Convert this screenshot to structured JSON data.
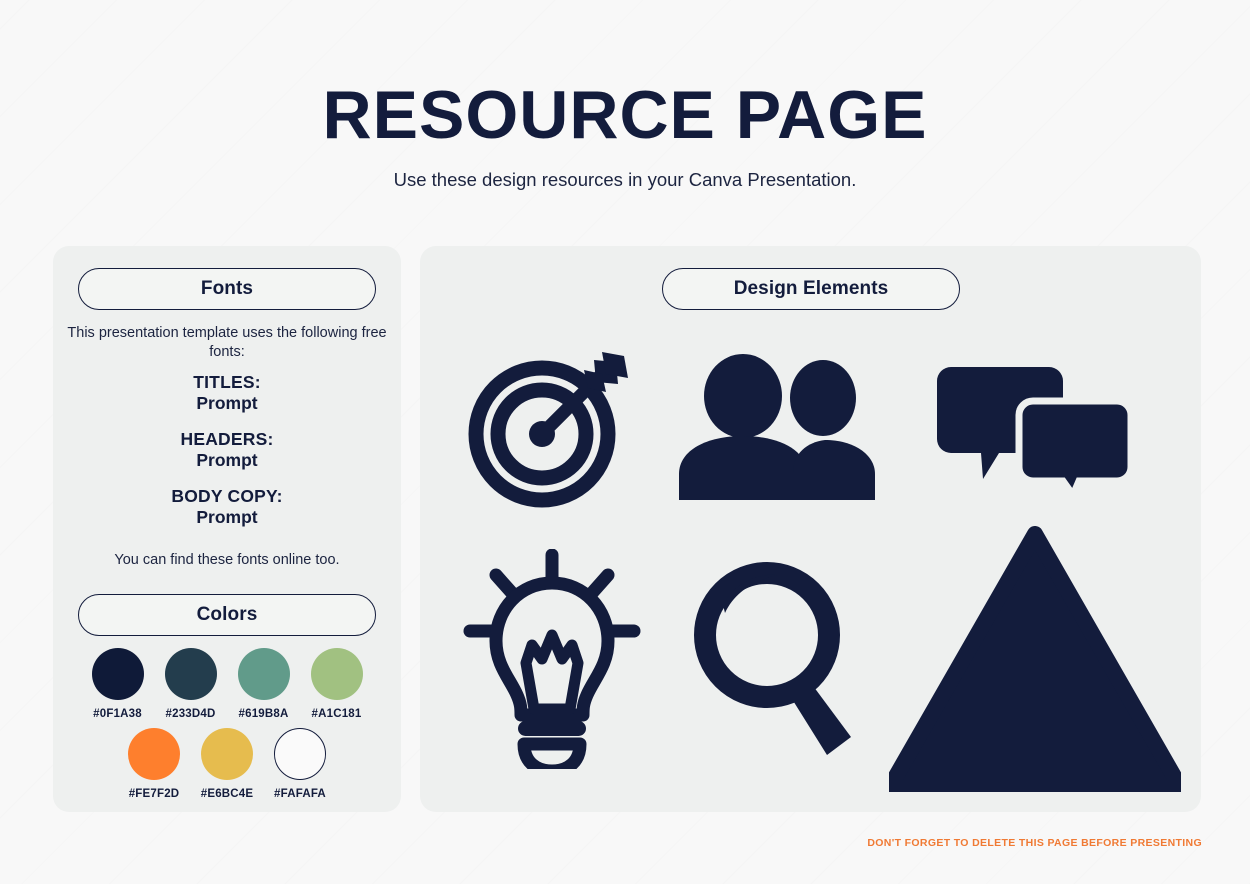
{
  "page": {
    "title": "RESOURCE PAGE",
    "subtitle": "Use these design resources in your Canva Presentation.",
    "background_color": "#F8F8F8",
    "ink_color": "#131C3C",
    "panel_color": "#EEF0EF"
  },
  "fonts_panel": {
    "heading": "Fonts",
    "intro": "This presentation template uses the following free fonts:",
    "groups": [
      {
        "role": "TITLES:",
        "font": "Prompt"
      },
      {
        "role": "HEADERS:",
        "font": "Prompt"
      },
      {
        "role": "BODY COPY:",
        "font": "Prompt"
      }
    ],
    "outro": "You can find these fonts online too."
  },
  "colors_panel": {
    "heading": "Colors",
    "row1": [
      {
        "hex": "#0F1A38",
        "label": "#0F1A38",
        "outlined": false
      },
      {
        "hex": "#233D4D",
        "label": "#233D4D",
        "outlined": false
      },
      {
        "hex": "#619B8A",
        "label": "#619B8A",
        "outlined": false
      },
      {
        "hex": "#A1C181",
        "label": "#A1C181",
        "outlined": false
      }
    ],
    "row2": [
      {
        "hex": "#FE7F2D",
        "label": "#FE7F2D",
        "outlined": false
      },
      {
        "hex": "#E6BC4E",
        "label": "#E6BC4E",
        "outlined": false
      },
      {
        "hex": "#FAFAFA",
        "label": "#FAFAFA",
        "outlined": true
      }
    ]
  },
  "design_elements_panel": {
    "heading": "Design Elements",
    "icons": [
      {
        "name": "target-arrow-icon"
      },
      {
        "name": "people-group-icon"
      },
      {
        "name": "speech-bubbles-icon"
      },
      {
        "name": "lightbulb-icon"
      },
      {
        "name": "magnifying-glass-icon"
      },
      {
        "name": "triangle-shape-icon"
      }
    ]
  },
  "footer": {
    "warning": "DON'T FORGET TO DELETE THIS PAGE BEFORE PRESENTING",
    "warning_color": "#F07A34"
  }
}
